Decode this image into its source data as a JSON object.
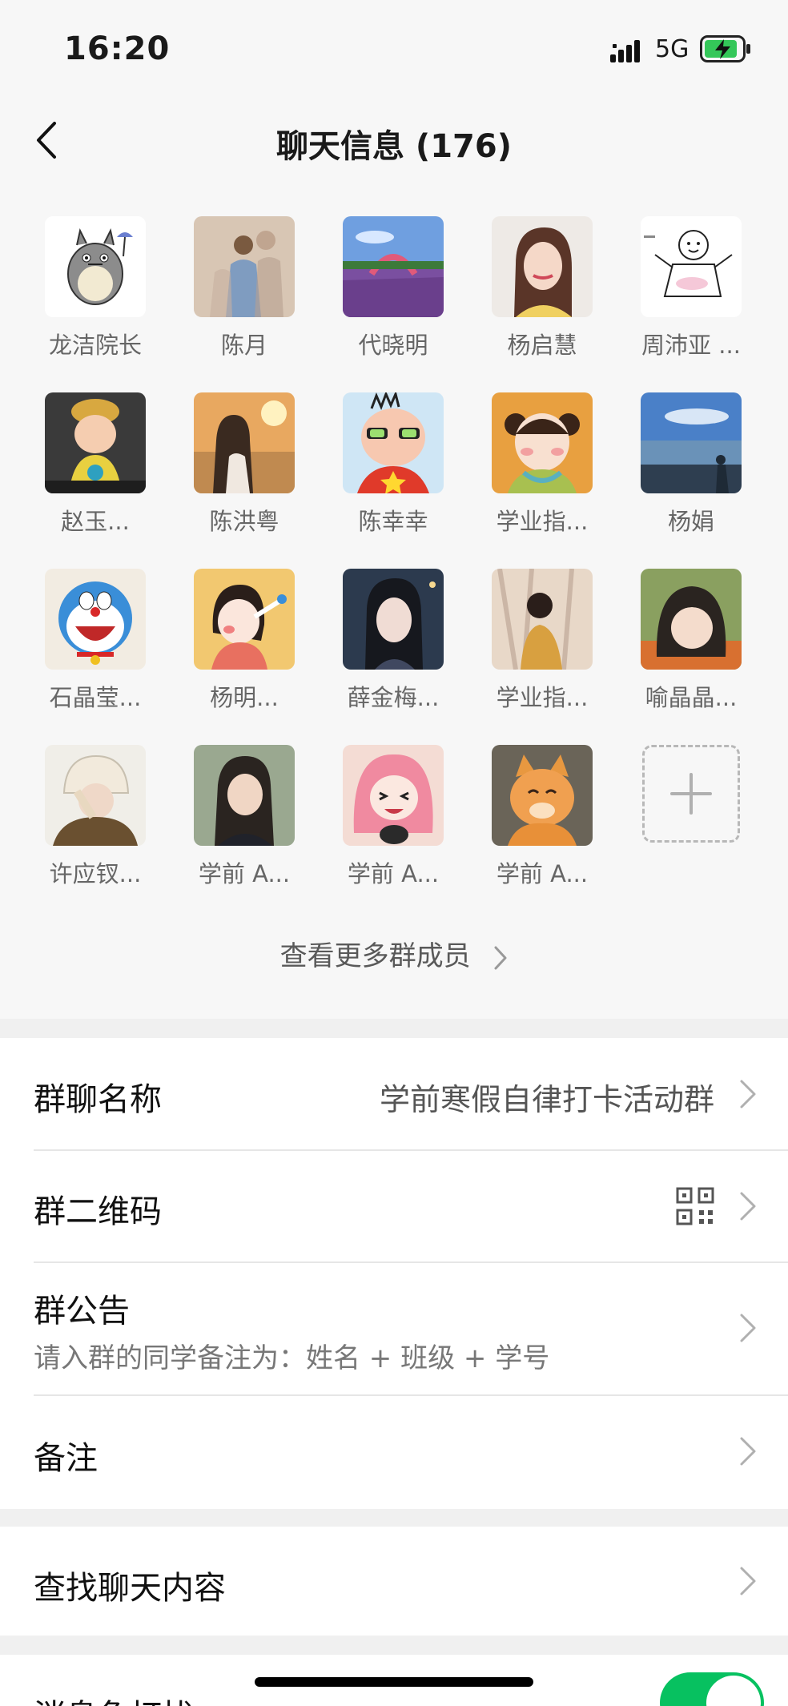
{
  "status_bar": {
    "time": "16:20",
    "network": "5G"
  },
  "header": {
    "title": "聊天信息 (176)"
  },
  "members": [
    {
      "name": "龙洁院长",
      "avatar": "totoro"
    },
    {
      "name": "陈月",
      "avatar": "couple-photo"
    },
    {
      "name": "代晓明",
      "avatar": "flower-field"
    },
    {
      "name": "杨启慧",
      "avatar": "girl-portrait"
    },
    {
      "name": "周沛亚 ...",
      "avatar": "cartoon-sketch"
    },
    {
      "name": "赵玉...",
      "avatar": "figurine"
    },
    {
      "name": "陈洪粤",
      "avatar": "sunset-girl"
    },
    {
      "name": "陈幸幸",
      "avatar": "cartoon-glasses"
    },
    {
      "name": "学业指...",
      "avatar": "cartoon-girl"
    },
    {
      "name": "杨娟",
      "avatar": "beach"
    },
    {
      "name": "石晶莹...",
      "avatar": "doraemon"
    },
    {
      "name": "杨明...",
      "avatar": "cartoon-eating"
    },
    {
      "name": "薛金梅...",
      "avatar": "dark-girl"
    },
    {
      "name": "学业指...",
      "avatar": "tree-shadow"
    },
    {
      "name": "喻晶晶...",
      "avatar": "anime-girl"
    },
    {
      "name": "许应钗...",
      "avatar": "hat-girl"
    },
    {
      "name": "学前 A...",
      "avatar": "portrait"
    },
    {
      "name": "学前 A...",
      "avatar": "pink-hair"
    },
    {
      "name": "学前 A...",
      "avatar": "cat"
    }
  ],
  "more_members": {
    "label": "查看更多群成员"
  },
  "settings": {
    "group_name": {
      "label": "群聊名称",
      "value": "学前寒假自律打卡活动群"
    },
    "qr_code": {
      "label": "群二维码"
    },
    "announcement": {
      "label": "群公告",
      "value": "请入群的同学备注为：姓名 + 班级 + 学号"
    },
    "remark": {
      "label": "备注"
    },
    "search": {
      "label": "查找聊天内容"
    },
    "mute": {
      "label": "消息免打扰",
      "enabled": true
    }
  },
  "colors": {
    "accent": "#07c160",
    "battery": "#34c759"
  }
}
